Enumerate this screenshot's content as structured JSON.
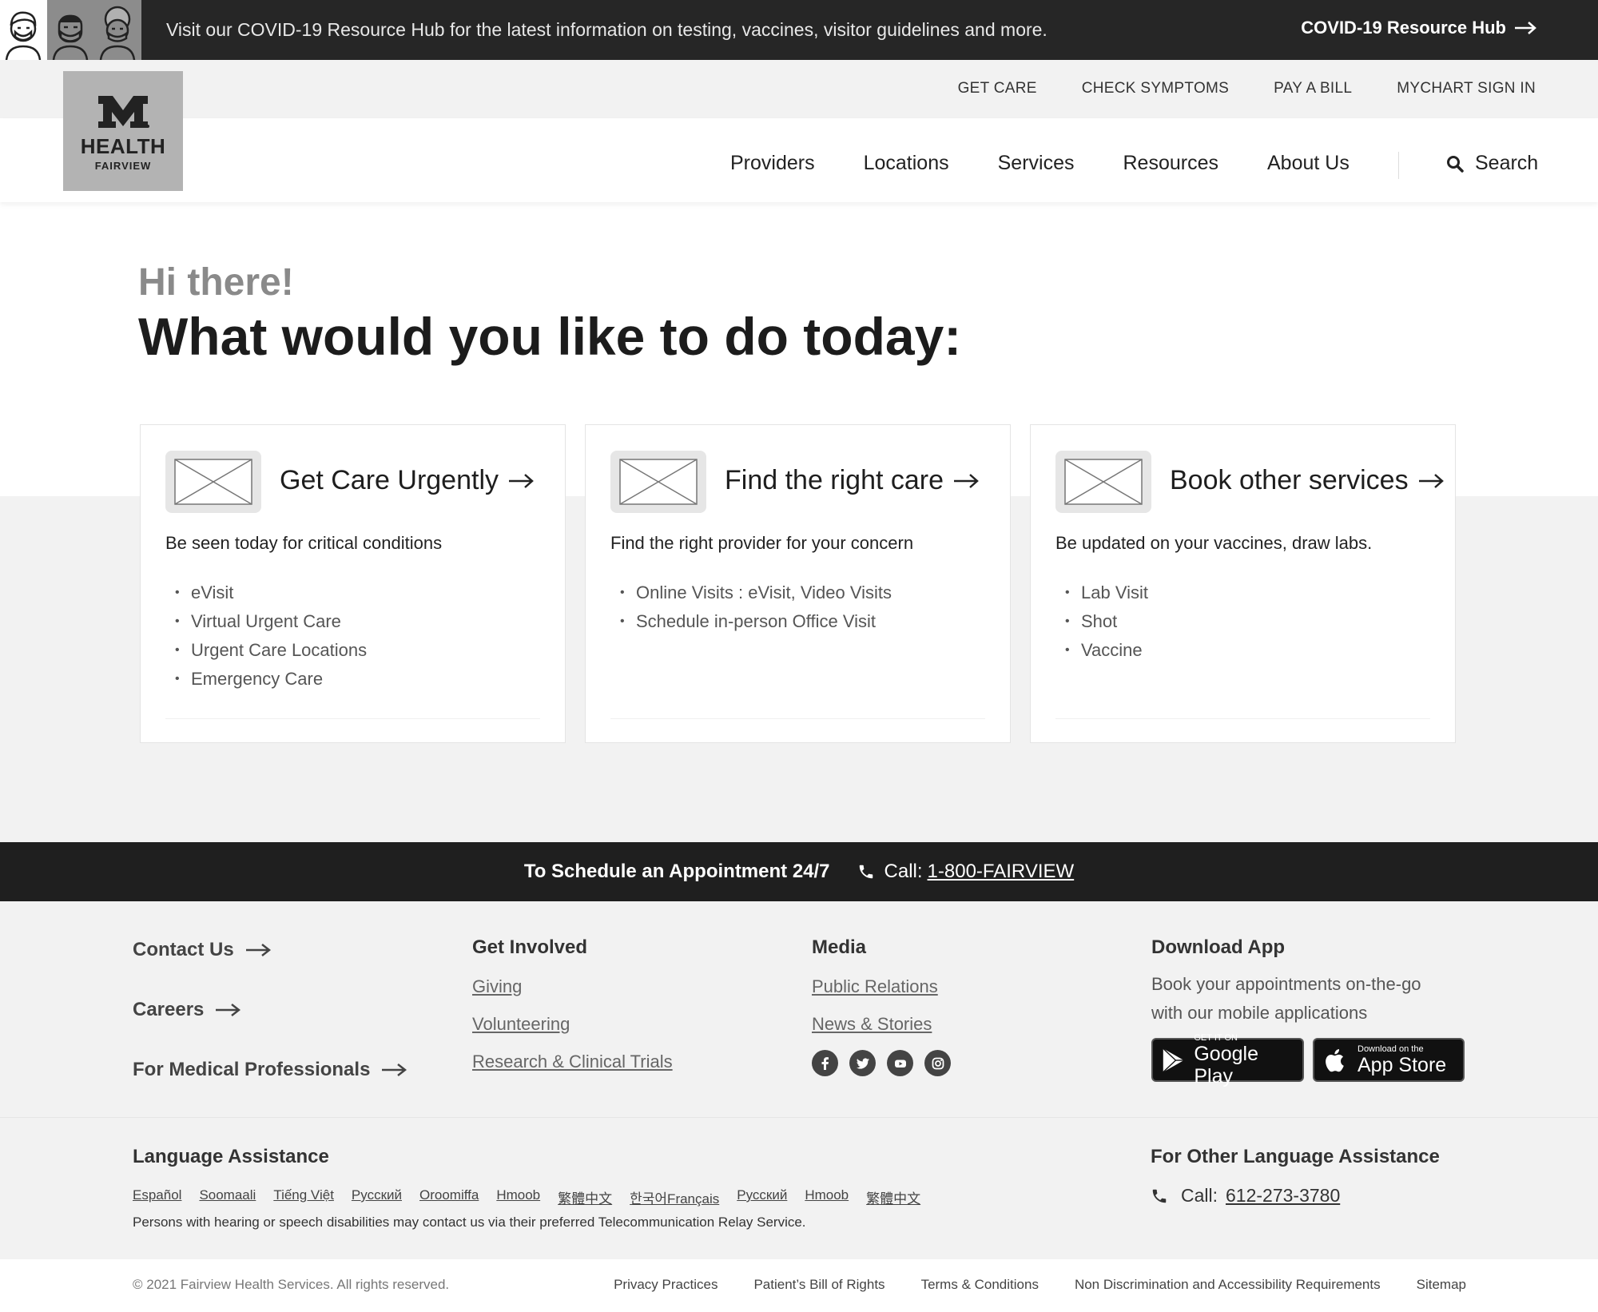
{
  "banner": {
    "message": "Visit our COVID-19 Resource Hub for the latest information on testing, vaccines, visitor guidelines and more.",
    "link_label": "COVID-19 Resource Hub"
  },
  "utility_nav": [
    "GET CARE",
    "CHECK SYMPTOMS",
    "PAY A BILL",
    "MYCHART SIGN IN"
  ],
  "logo": {
    "line1": "HEALTH",
    "line2": "FAIRVIEW"
  },
  "main_nav": [
    "Providers",
    "Locations",
    "Services",
    "Resources",
    "About Us"
  ],
  "search_label": "Search",
  "hero": {
    "greeting": "Hi there!",
    "headline": "What would you like to do today:"
  },
  "cards": [
    {
      "title": "Get Care Urgently",
      "description": "Be seen today for critical conditions",
      "items": [
        "eVisit",
        "Virtual Urgent Care",
        "Urgent Care Locations",
        "Emergency Care"
      ]
    },
    {
      "title": "Find the right care",
      "description": "Find the right provider for your concern",
      "items": [
        "Online Visits : eVisit, Video Visits",
        "Schedule in-person Office Visit"
      ]
    },
    {
      "title": "Book other services",
      "description": "Be updated on your vaccines, draw labs.",
      "items": [
        "Lab Visit",
        "Shot",
        "Vaccine"
      ]
    }
  ],
  "schedule": {
    "title": "To Schedule an Appointment 24/7",
    "call_label": "Call:",
    "phone": "1-800-FAIRVIEW"
  },
  "footer": {
    "quick_links": [
      "Contact Us",
      "Careers",
      "For Medical Professionals"
    ],
    "get_involved": {
      "heading": "Get Involved",
      "links": [
        "Giving",
        "Volunteering",
        "Research & Clinical Trials"
      ]
    },
    "media": {
      "heading": "Media",
      "links": [
        "Public Relations",
        "News & Stories"
      ],
      "social_icons": [
        "facebook-icon",
        "twitter-icon",
        "youtube-icon",
        "instagram-icon"
      ]
    },
    "app": {
      "heading": "Download App",
      "text": "Book your appointments on-the-go with our mobile applications",
      "google_small": "GET IT ON",
      "google_big": "Google Play",
      "apple_small": "Download on the",
      "apple_big": "App Store"
    },
    "language": {
      "heading": "Language Assistance",
      "languages": [
        "Español",
        "Soomaali",
        "Tiếng Việt",
        "Русский",
        "Oroomiffa",
        "Hmoob",
        "繁體中文",
        "한국어Français",
        "Русский",
        "Hmoob",
        "繁體中文"
      ],
      "note": "Persons with hearing or speech disabilities may contact us via their preferred Telecommunication Relay Service."
    },
    "other_language": {
      "heading": "For Other Language Assistance",
      "call_label": "Call:",
      "phone": "612-273-3780"
    },
    "copyright": "© 2021 Fairview Health Services. All rights reserved.",
    "legal_links": [
      "Privacy Practices",
      "Patient’s Bill of Rights",
      "Terms & Conditions",
      "Non Discrimination and Accessibility Requirements",
      "Sitemap"
    ]
  }
}
